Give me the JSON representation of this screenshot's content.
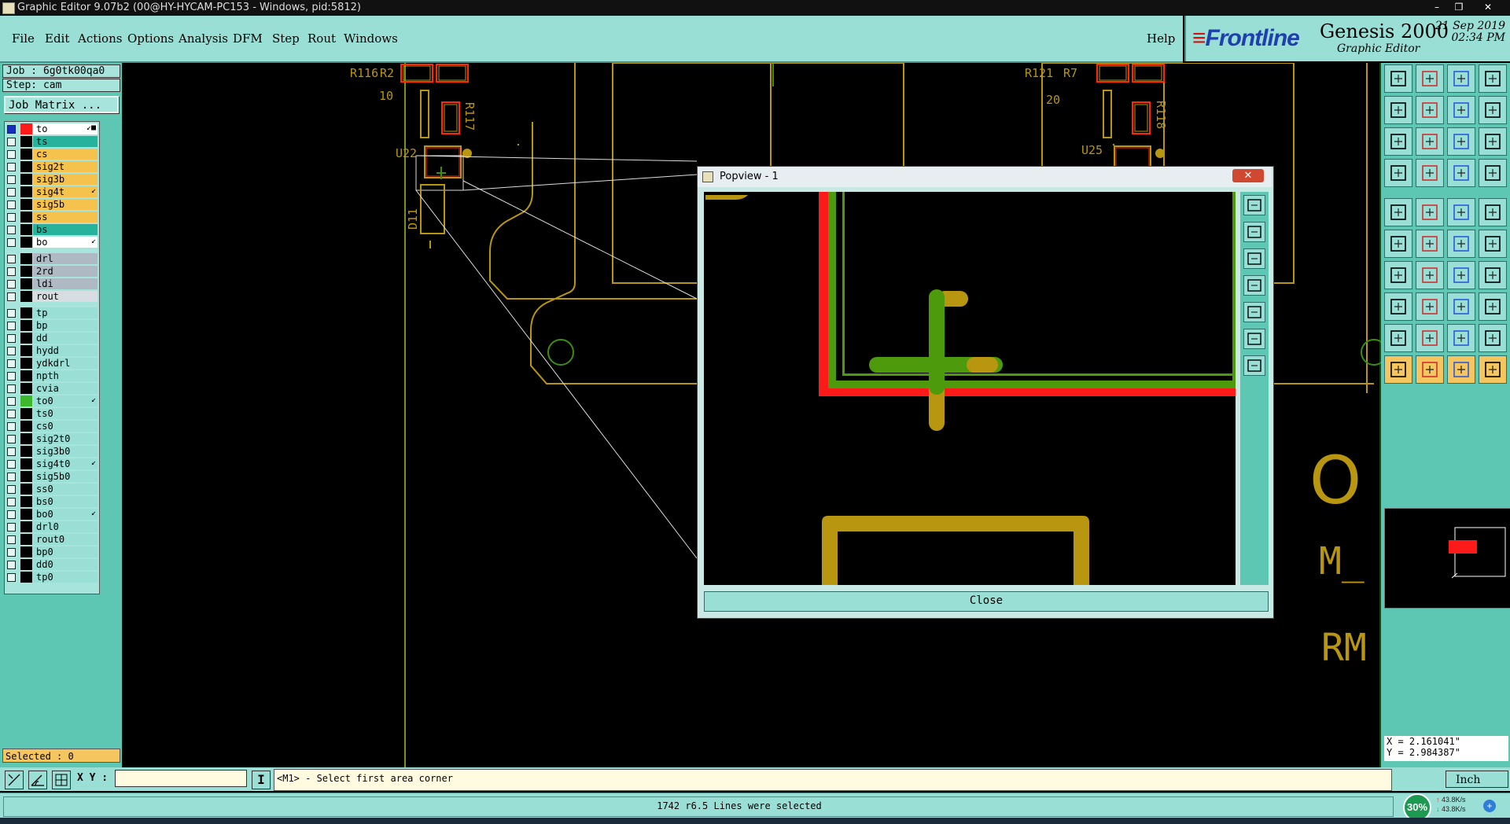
{
  "window": {
    "title": "Graphic Editor 9.07b2 (00@HY-HYCAM-PC153 - Windows, pid:5812)",
    "controls": [
      "–",
      "❐",
      "✕"
    ]
  },
  "menu": {
    "items": [
      {
        "label": "File"
      },
      {
        "label": "Edit"
      },
      {
        "label": "Actions"
      },
      {
        "label": "Options"
      },
      {
        "label": "Analysis"
      },
      {
        "label": "DFM"
      },
      {
        "label": "Step"
      },
      {
        "label": "Rout"
      },
      {
        "label": "Windows"
      }
    ],
    "help": "Help"
  },
  "brand": {
    "logo": "Frontline",
    "product": "Genesis 2000",
    "subtitle": "Graphic Editor",
    "date": "21 Sep 2019",
    "time": "02:34 PM"
  },
  "job": {
    "job_label": "Job : 6g0tk00qa0",
    "step_label": "Step: cam",
    "matrix_button": "Job Matrix ..."
  },
  "layers": [
    {
      "name": "to",
      "swatch": "#ff1a1a",
      "bg": "#ffffff",
      "mark": "↙■"
    },
    {
      "name": "ts",
      "swatch": "#000000",
      "bg": "#27b39b"
    },
    {
      "name": "cs",
      "swatch": "#000000",
      "bg": "#f5c24e"
    },
    {
      "name": "sig2t",
      "swatch": "#000000",
      "bg": "#f5c24e"
    },
    {
      "name": "sig3b",
      "swatch": "#000000",
      "bg": "#f5c24e"
    },
    {
      "name": "sig4t",
      "swatch": "#000000",
      "bg": "#f5c24e",
      "mark": "↙"
    },
    {
      "name": "sig5b",
      "swatch": "#000000",
      "bg": "#f5c24e"
    },
    {
      "name": "ss",
      "swatch": "#000000",
      "bg": "#f5c24e"
    },
    {
      "name": "bs",
      "swatch": "#000000",
      "bg": "#27b39b"
    },
    {
      "name": "bo",
      "swatch": "#000000",
      "bg": "#ffffff",
      "mark": "↙"
    },
    {
      "name": "drl",
      "swatch": "#000000",
      "bg": "#aeb9c4"
    },
    {
      "name": "2rd",
      "swatch": "#000000",
      "bg": "#aeb9c4"
    },
    {
      "name": "ldi",
      "swatch": "#000000",
      "bg": "#aeb9c4"
    },
    {
      "name": "rout",
      "swatch": "#000000",
      "bg": "#d8dde2"
    },
    {
      "name": "tp",
      "swatch": "#000000",
      "bg": "#9adfd6"
    },
    {
      "name": "bp",
      "swatch": "#000000",
      "bg": "#9adfd6"
    },
    {
      "name": "dd",
      "swatch": "#000000",
      "bg": "#9adfd6"
    },
    {
      "name": "hydd",
      "swatch": "#000000",
      "bg": "#9adfd6"
    },
    {
      "name": "ydkdrl",
      "swatch": "#000000",
      "bg": "#9adfd6"
    },
    {
      "name": "npth",
      "swatch": "#000000",
      "bg": "#9adfd6"
    },
    {
      "name": "cvia",
      "swatch": "#000000",
      "bg": "#9adfd6"
    },
    {
      "name": "to0",
      "swatch": "#3db82c",
      "bg": "#9adfd6",
      "mark": "↙"
    },
    {
      "name": "ts0",
      "swatch": "#000000",
      "bg": "#9adfd6"
    },
    {
      "name": "cs0",
      "swatch": "#000000",
      "bg": "#9adfd6"
    },
    {
      "name": "sig2t0",
      "swatch": "#000000",
      "bg": "#9adfd6"
    },
    {
      "name": "sig3b0",
      "swatch": "#000000",
      "bg": "#9adfd6"
    },
    {
      "name": "sig4t0",
      "swatch": "#000000",
      "bg": "#9adfd6",
      "mark": "↙"
    },
    {
      "name": "sig5b0",
      "swatch": "#000000",
      "bg": "#9adfd6"
    },
    {
      "name": "ss0",
      "swatch": "#000000",
      "bg": "#9adfd6"
    },
    {
      "name": "bs0",
      "swatch": "#000000",
      "bg": "#9adfd6"
    },
    {
      "name": "bo0",
      "swatch": "#000000",
      "bg": "#9adfd6",
      "mark": "↙"
    },
    {
      "name": "drl0",
      "swatch": "#000000",
      "bg": "#9adfd6"
    },
    {
      "name": "rout0",
      "swatch": "#000000",
      "bg": "#9adfd6"
    },
    {
      "name": "bp0",
      "swatch": "#000000",
      "bg": "#9adfd6"
    },
    {
      "name": "dd0",
      "swatch": "#000000",
      "bg": "#9adfd6"
    },
    {
      "name": "tp0",
      "swatch": "#000000",
      "bg": "#9adfd6"
    }
  ],
  "selected": "Selected : 0",
  "canvas_labels": {
    "r116": "R116",
    "r2": "R2",
    "n10": "10",
    "r117": "R117",
    "u22": "U22",
    "d11": "D11",
    "r121": "R121",
    "r7": "R7",
    "n20": "20",
    "r118": "R118",
    "u25": "U25",
    "big_o": "O",
    "m": "M_",
    "rm": "RM"
  },
  "popview": {
    "title": "Popview - 1",
    "close_label": "Close"
  },
  "coords": {
    "x": "X = 2.161041\"",
    "y": "Y = 2.984387\""
  },
  "command": {
    "xy_label": "X Y :",
    "xy_value": "",
    "prompt": "<M1> - Select first area corner",
    "units": "Inch"
  },
  "status": {
    "message": "1742 r6.5 Lines were selected",
    "net_percent": "30%",
    "upload": "43.8K/s",
    "download": "43.8K/s"
  },
  "colors": {
    "panel_bg": "#5ec7b4",
    "button_bg": "#9adfd6",
    "outline_yellow": "#b8960f",
    "green_layer": "#4d9a0c",
    "red_layer": "#ff1a1a"
  }
}
